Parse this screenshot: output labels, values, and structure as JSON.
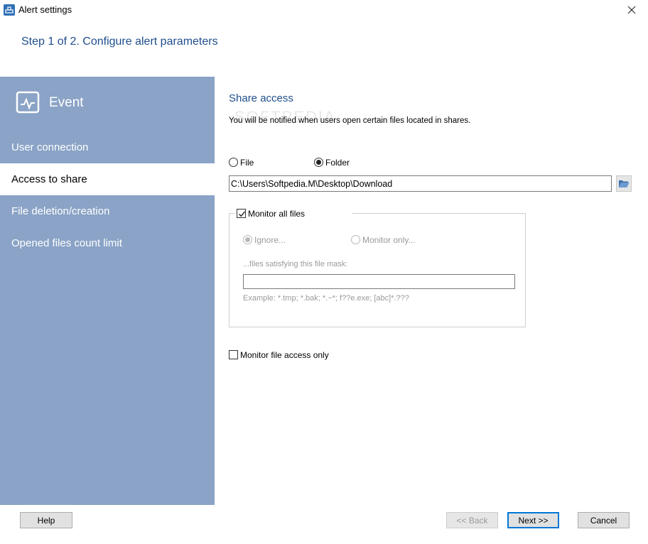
{
  "window": {
    "title": "Alert settings"
  },
  "step_title": "Step 1 of 2. Configure alert parameters",
  "sidebar": {
    "header": "Event",
    "items": [
      {
        "label": "User connection",
        "active": false
      },
      {
        "label": "Access to share",
        "active": true
      },
      {
        "label": "File deletion/creation",
        "active": false
      },
      {
        "label": "Opened files count limit",
        "active": false
      }
    ]
  },
  "main": {
    "section_title": "Share access",
    "description": "You will be notified when users open certain files located in shares.",
    "watermark": "SOFTPEDIA",
    "target": {
      "file_label": "File",
      "folder_label": "Folder",
      "selected": "folder"
    },
    "path_value": "C:\\Users\\Softpedia.M\\Desktop\\Download",
    "monitor_all": {
      "label": "Monitor all files",
      "checked": true
    },
    "mode": {
      "ignore_label": "Ignore...",
      "monitor_only_label": "Monitor only...",
      "selected": "ignore"
    },
    "mask_label": "...files satisfying this file mask:",
    "mask_value": "",
    "example": "Example: *.tmp; *.bak; *.~*; f??e.exe; [abc]*.???",
    "access_only": {
      "label": "Monitor file access only",
      "checked": false
    }
  },
  "buttons": {
    "help": "Help",
    "back": "<< Back",
    "next": "Next >>",
    "cancel": "Cancel"
  },
  "colors": {
    "sidebar_bg": "#8aa3c6",
    "accent_text": "#1f4e8c",
    "default_button_border": "#0078d7"
  }
}
